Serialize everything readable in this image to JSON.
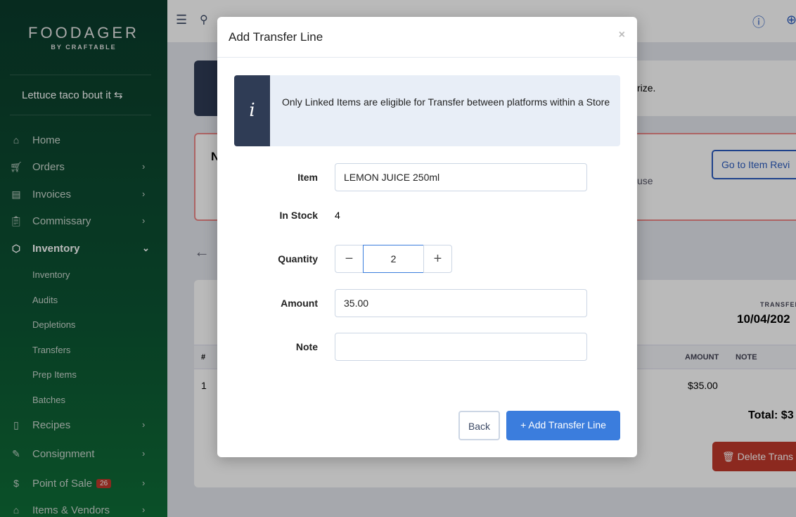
{
  "sidebar": {
    "logo": "FOODAGER",
    "logo_sub": "BY CRAFTABLE",
    "store": "Lettuce taco bout it",
    "items": [
      {
        "label": "Home"
      },
      {
        "label": "Orders"
      },
      {
        "label": "Invoices"
      },
      {
        "label": "Commissary"
      },
      {
        "label": "Inventory"
      }
    ],
    "subitems": [
      "Inventory",
      "Audits",
      "Depletions",
      "Transfers",
      "Prep Items",
      "Batches"
    ],
    "items2": [
      {
        "label": "Recipes"
      },
      {
        "label": "Consignment"
      },
      {
        "label": "Point of Sale",
        "badge": "26"
      },
      {
        "label": "Items & Vendors"
      }
    ]
  },
  "background": {
    "info_text_fragment": "rize.",
    "warning_title_fragment": "N",
    "warning_text_fragment": "use",
    "go_review": "Go to Item Revi",
    "transfer_label": "TRANSFER",
    "transfer_date": "10/04/202",
    "table": {
      "hash": "#",
      "amount": "AMOUNT",
      "note": "NOTE",
      "row_num": "1",
      "row_amount": "$35.00"
    },
    "total": "Total: $3",
    "delete": "Delete Trans"
  },
  "modal": {
    "title": "Add Transfer Line",
    "close": "×",
    "info": "Only Linked Items are eligible for Transfer between platforms within a Store",
    "item_label": "Item",
    "item_value": "LEMON JUICE 250ml",
    "stock_label": "In Stock",
    "stock_value": "4",
    "qty_label": "Quantity",
    "qty_value": "2",
    "minus": "−",
    "plus": "+",
    "amount_label": "Amount",
    "amount_value": "35.00",
    "note_label": "Note",
    "note_value": "",
    "back": "Back",
    "add": "+ Add Transfer Line"
  },
  "colors": {
    "primary": "#3b7ddd",
    "danger": "#c0392b",
    "sidebar": "#0c5433"
  }
}
